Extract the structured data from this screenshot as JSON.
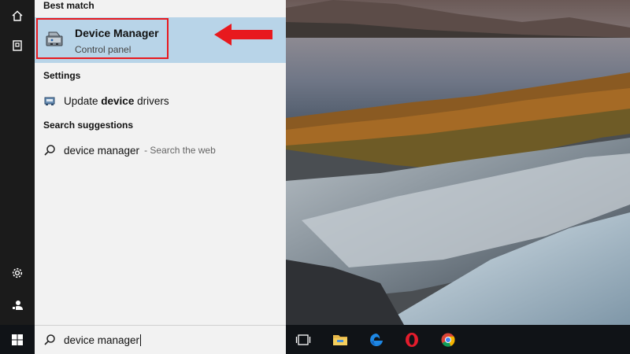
{
  "search": {
    "query": "device manager",
    "sections": {
      "best_match": "Best match",
      "settings": "Settings",
      "search_suggestions": "Search suggestions"
    },
    "best_match_item": {
      "title": "Device Manager",
      "subtitle": "Control panel"
    },
    "settings_item": {
      "prefix": "Update ",
      "bold": "device",
      "suffix": " drivers"
    },
    "suggestion_item": {
      "text": "device manager",
      "hint": "- Search the web"
    }
  },
  "rail_icons": [
    "home-icon",
    "document-icon",
    "gear-icon",
    "user-icon"
  ],
  "taskbar_icons": [
    "task-view-icon",
    "file-explorer-icon",
    "edge-icon",
    "opera-icon",
    "chrome-icon"
  ],
  "colors": {
    "highlight_border": "#e8191e",
    "selected_bg": "#b8d4e8",
    "panel_bg": "#f2f2f2",
    "taskbar_bg": "#101317",
    "arrow": "#e8191e"
  }
}
